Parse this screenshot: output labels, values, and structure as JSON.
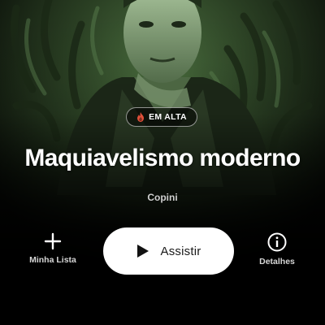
{
  "hero": {
    "title": "Maquiavelismo moderno",
    "subtitle": "Copini",
    "badge": {
      "label": "EM ALTA",
      "icon": "fire-icon",
      "icon_color": "#e0503a"
    }
  },
  "actions": {
    "my_list": {
      "label": "Minha Lista",
      "icon": "plus-icon"
    },
    "play": {
      "label": "Assistir",
      "icon": "play-icon"
    },
    "details": {
      "label": "Detalhes",
      "icon": "info-icon"
    }
  },
  "colors": {
    "background": "#000000",
    "hero_tint": "#3c5a33",
    "play_button": "#ffffff",
    "play_text": "#1a1a1a"
  }
}
